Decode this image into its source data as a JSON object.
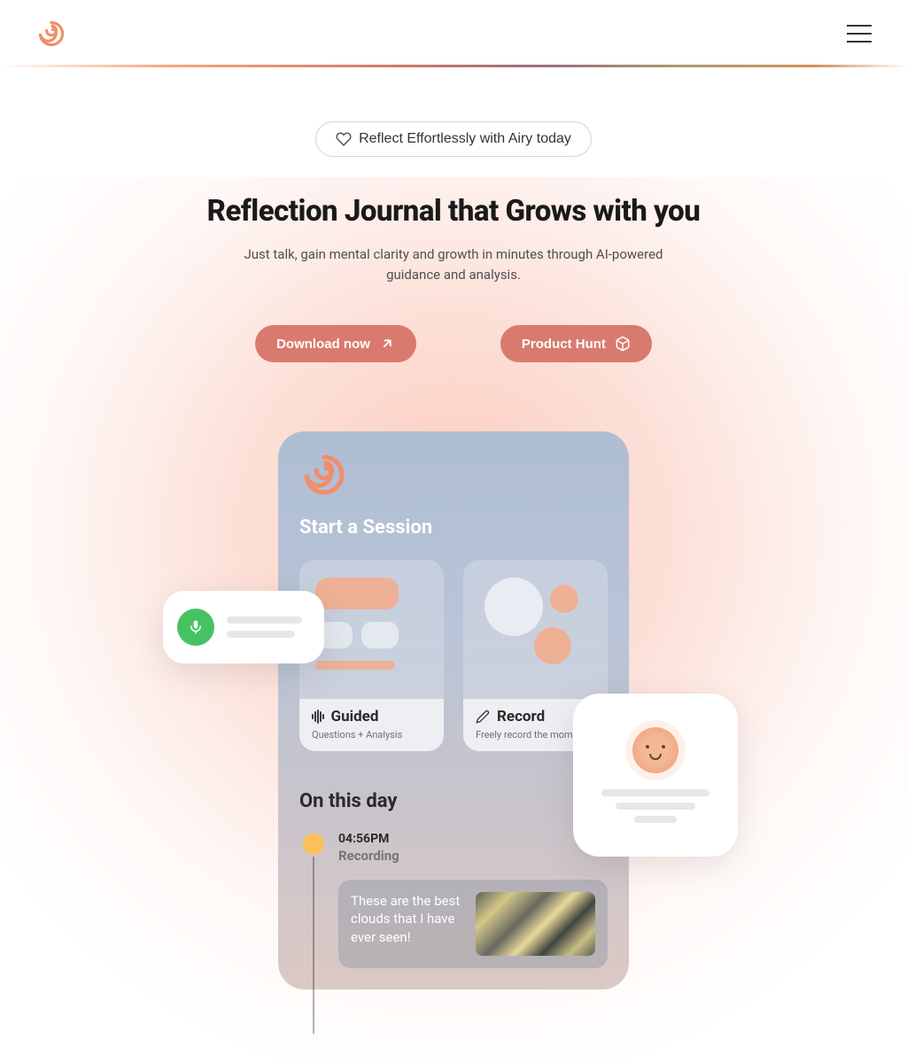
{
  "hero": {
    "pill_label": "Reflect Effortlessly with Airy today",
    "headline": "Reflection Journal that Grows with you",
    "subhead": "Just talk, gain mental clarity and growth in minutes through AI-powered guidance and analysis.",
    "cta_download": "Download now",
    "cta_producthunt": "Product Hunt"
  },
  "phone": {
    "start_session": "Start a Session",
    "cards": {
      "guided": {
        "title": "Guided",
        "sub": "Questions + Analysis"
      },
      "record": {
        "title": "Record",
        "sub": "Freely record the moment"
      }
    },
    "on_this_day": "On this day",
    "entry": {
      "time": "04:56PM",
      "label": "Recording",
      "text": "These are the best clouds that I have ever seen!"
    }
  },
  "colors": {
    "accent": "#d97a6f",
    "logo": "#f08e6a"
  }
}
